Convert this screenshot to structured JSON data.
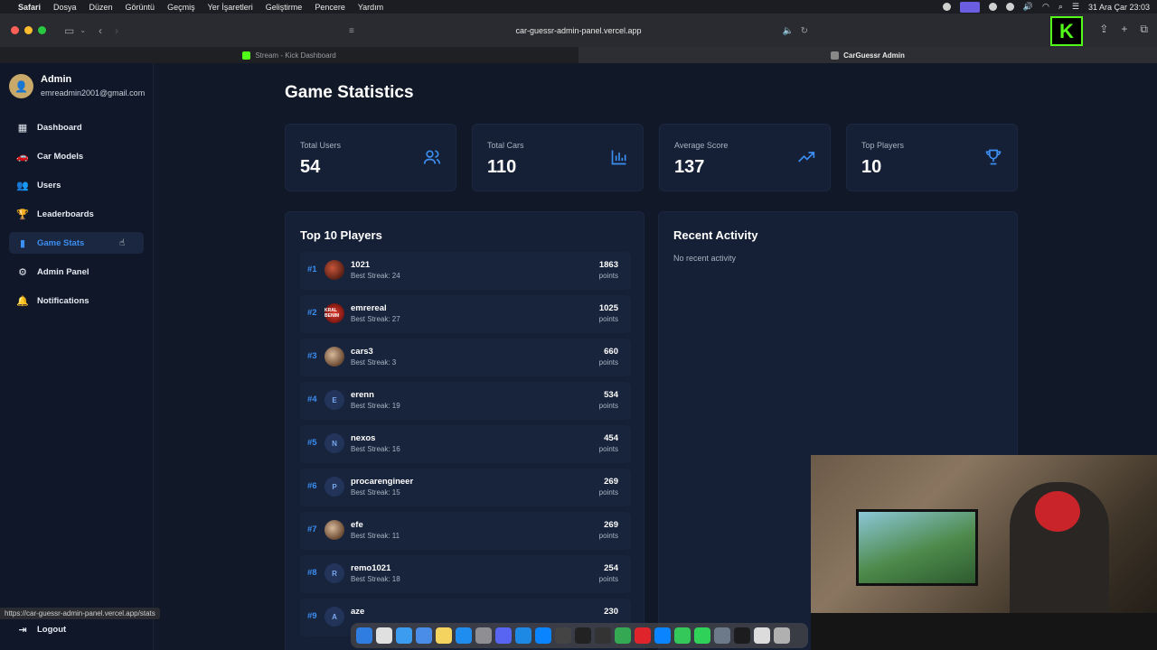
{
  "menubar": {
    "app_name": "Safari",
    "menus": [
      "Dosya",
      "Düzen",
      "Görüntü",
      "Geçmiş",
      "Yer İşaretleri",
      "Geliştirme",
      "Pencere",
      "Yardım"
    ],
    "clock": "31 Ara Çar  23:03"
  },
  "browser": {
    "url": "car-guessr-admin-panel.vercel.app",
    "tabs": [
      {
        "title": "Stream - Kick Dashboard",
        "favicon_color": "#53fc18"
      },
      {
        "title": "CarGuessr Admin",
        "favicon_color": "#888888"
      }
    ],
    "kick_logo": "K",
    "status_url": "https://car-guessr-admin-panel.vercel.app/stats"
  },
  "sidebar": {
    "user": {
      "name": "Admin",
      "email": "emreadmin2001@gmail.com"
    },
    "items": [
      {
        "label": "Dashboard",
        "icon": "dashboard-icon"
      },
      {
        "label": "Car Models",
        "icon": "car-icon"
      },
      {
        "label": "Users",
        "icon": "users-icon"
      },
      {
        "label": "Leaderboards",
        "icon": "trophy-icon"
      },
      {
        "label": "Game Stats",
        "icon": "bar-chart-icon",
        "active": true
      },
      {
        "label": "Admin Panel",
        "icon": "gear-icon"
      },
      {
        "label": "Notifications",
        "icon": "bell-icon"
      }
    ],
    "logout_label": "Logout"
  },
  "main": {
    "title": "Game Statistics",
    "stats": [
      {
        "label": "Total Users",
        "value": "54",
        "icon": "users-icon"
      },
      {
        "label": "Total Cars",
        "value": "110",
        "icon": "bar-chart-icon"
      },
      {
        "label": "Average Score",
        "value": "137",
        "icon": "trending-up-icon"
      },
      {
        "label": "Top Players",
        "value": "10",
        "icon": "trophy-icon"
      }
    ],
    "top_players": {
      "title": "Top 10 Players",
      "points_label": "points",
      "players": [
        {
          "rank": "#1",
          "name": "1021",
          "streak": "Best Streak: 24",
          "points": "1863",
          "avatar": ""
        },
        {
          "rank": "#2",
          "name": "emrereal",
          "streak": "Best Streak: 27",
          "points": "1025",
          "avatar": "KRAL BENIM"
        },
        {
          "rank": "#3",
          "name": "cars3",
          "streak": "Best Streak: 3",
          "points": "660",
          "avatar": ""
        },
        {
          "rank": "#4",
          "name": "erenn",
          "streak": "Best Streak: 19",
          "points": "534",
          "avatar": "E"
        },
        {
          "rank": "#5",
          "name": "nexos",
          "streak": "Best Streak: 16",
          "points": "454",
          "avatar": "N"
        },
        {
          "rank": "#6",
          "name": "procarengineer",
          "streak": "Best Streak: 15",
          "points": "269",
          "avatar": "P"
        },
        {
          "rank": "#7",
          "name": "efe",
          "streak": "Best Streak: 11",
          "points": "269",
          "avatar": ""
        },
        {
          "rank": "#8",
          "name": "remo1021",
          "streak": "Best Streak: 18",
          "points": "254",
          "avatar": "R"
        },
        {
          "rank": "#9",
          "name": "aze",
          "streak": "",
          "points": "230",
          "avatar": "A"
        }
      ]
    },
    "recent_activity": {
      "title": "Recent Activity",
      "empty_text": "No recent activity"
    }
  },
  "colors": {
    "accent": "#3b8ef2",
    "background": "#111827",
    "card": "#152036",
    "sidebar": "#0f1729"
  }
}
